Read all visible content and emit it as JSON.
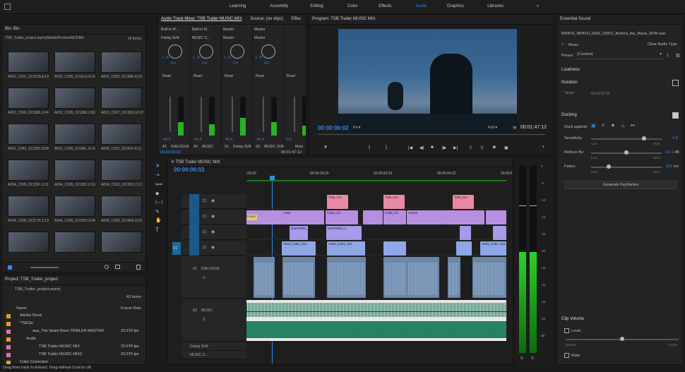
{
  "workspaces": [
    "Learning",
    "Assembly",
    "Editing",
    "Color",
    "Effects",
    "Audio",
    "Graphics",
    "Libraries"
  ],
  "active_workspace": "Audio",
  "more_glyph": "»",
  "bin": {
    "title": "Bin: Bin",
    "path": "TSB_Trailer_project.prproj\\Media\\Proxies\\AED\\Bin",
    "count": "18 Items",
    "clips": [
      {
        "name": "A002_C001_0213US...",
        "dur": "4:19"
      },
      {
        "name": "A002_C005_0213LG...",
        "dur": "4:16"
      },
      {
        "name": "A002_C005_02138K...",
        "dur": "4:23"
      },
      {
        "name": "A002_C000_021388...",
        "dur": "3:04"
      },
      {
        "name": "A002_C005_021388...",
        "dur": "3:06"
      },
      {
        "name": "A002_C007_02130G...",
        "dur": "10:07"
      },
      {
        "name": "A002_C042_021306...",
        "dur": "8:58"
      },
      {
        "name": "A001_C006_02130L...",
        "dur": "4:15"
      },
      {
        "name": "A004_C001_02156V...",
        "dur": "4:11"
      },
      {
        "name": "A004_C005_02135F...",
        "dur": "3:21"
      },
      {
        "name": "A004_C005_021350...",
        "dur": "3:16"
      },
      {
        "name": "A004_C005_02136X...",
        "dur": "2:12"
      },
      {
        "name": "A004_C006_02117H...",
        "dur": "2:13"
      },
      {
        "name": "A004_C006_02135H...",
        "dur": "3:04"
      },
      {
        "name": "A004_C006_0214KE...",
        "dur": "3:19"
      },
      {
        "name": "",
        "dur": ""
      },
      {
        "name": "",
        "dur": ""
      },
      {
        "name": "",
        "dur": ""
      }
    ]
  },
  "project": {
    "title": "Project: TSB_Trailer_project",
    "file": "TSB_Trailer_project.prproj",
    "count": "43 Items",
    "col_name": "Name",
    "col_rate": "Frame Rate",
    "items": [
      {
        "name": "Adobe Stock",
        "rate": "",
        "color": "#e0a030",
        "indent": 1
      },
      {
        "name": "**SEQs",
        "rate": "",
        "color": "#e0a030",
        "indent": 1
      },
      {
        "name": "aaa_The Seam  Boen TRAILER MASTER",
        "rate": "23.976 fps",
        "color": "#e070b0",
        "indent": 3
      },
      {
        "name": "Audio",
        "rate": "",
        "color": "#e0a030",
        "indent": 2
      },
      {
        "name": "TSB Trailer MUSIC MIX",
        "rate": "23.976 fps",
        "color": "#e070b0",
        "indent": 4
      },
      {
        "name": "TSB Trailer MUSIC MIX2",
        "rate": "23.976 fps",
        "color": "#e070b0",
        "indent": 4
      },
      {
        "name": "Color Correction",
        "rate": "",
        "color": "#e0a030",
        "indent": 1
      }
    ]
  },
  "status_bar": "Drag from track to Extract. Drag without Cmd to Lift.",
  "mixer": {
    "tab1": "Audio Track Mixer: TSB Trailer MUSIC MIX",
    "tab2": "Source: (no clips)",
    "tab3": "Effec",
    "timecode": "00:00:06:02",
    "duration": "00:01:47:12",
    "channels": [
      {
        "input": "Built-in M...",
        "output": "Dialog SUB",
        "value": "0.0",
        "auto": "Read",
        "peak": "-40.4",
        "lbl": "A1",
        "name": "DIALOGUE",
        "lr": "L  R",
        "level": 0.35
      },
      {
        "input": "Built-in M...",
        "output": "MUSIC S...",
        "value": "0.0",
        "auto": "Read",
        "peak": "-41.4",
        "lbl": "A2",
        "name": "MUSIC",
        "lr": "L  R",
        "level": 0.3
      },
      {
        "input": "Master",
        "output": "Master",
        "value": "0.0",
        "auto": "Read",
        "peak": "-40.4",
        "lbl": "S1",
        "name": "Dialog SUB",
        "lr": "L  R",
        "level": 0.45
      },
      {
        "input": "Master",
        "output": "Master",
        "value": "0.0",
        "auto": "Read",
        "peak": "-40.4",
        "lbl": "S2",
        "name": "MUSIC SUB",
        "lr": "L  R",
        "level": 0.35
      },
      {
        "input": "",
        "output": "",
        "value": "",
        "auto": "Read",
        "peak": "0.0",
        "lbl": "",
        "name": "Mast",
        "lr": "",
        "level": 0.25
      }
    ]
  },
  "program": {
    "title": "Program: TSB Trailer MUSIC MIX",
    "timecode": "00:00:06:02",
    "fit": "Fit",
    "quality": "Full",
    "duration": "00:01:47:12"
  },
  "timeline": {
    "title": "TSB Trailer MUSIC MIX",
    "timecode": "00:00:06:02",
    "ruler": [
      ":00:00",
      "00:00:14:23",
      "00:00:29:23",
      "00:00:44:22",
      "00:00:5"
    ],
    "video_tracks": [
      "V4",
      "V3",
      "V2",
      "V1"
    ],
    "audio_tracks": [
      "A1",
      "A2"
    ],
    "a1_name": "DIALOGUE",
    "a2_name": "MUSIC",
    "sub1": "Dialog SUB",
    "sub2": "MUSIC S...",
    "v1_src": "V1",
    "clip_labels": {
      "tsb1": "TSB_Cre",
      "tsb2": "TSB_Cre",
      "tsb3": "TSB_Cre",
      "a002": "A002",
      "c003": "C003_C0",
      "c005": "C005_C0",
      "c1": "C3025",
      "b1": "B15TR001_1",
      "b2": "B15TR001_1",
      "b3": "A003_C001_021",
      "b4": "A003_C001_021",
      "b5": "A003_C001_021",
      "cross": "Cross"
    },
    "a1_db": "0.",
    "a2_db": "0."
  },
  "meters": {
    "scale": [
      "0",
      "-6",
      "-12",
      "-18",
      "-24",
      "-30",
      "-36",
      "-42",
      "-48",
      "-54",
      "dB"
    ],
    "solo": "S"
  },
  "essential": {
    "title": "Essential Sound",
    "file": "MPATH_MPATH_0002_03001_Behind_the_Wave_APM.wav",
    "type": "Music",
    "clear": "Clear Audio Type",
    "preset_label": "Preset:",
    "preset_value": "(Custom)",
    "loudness": "Loudness",
    "duration": "Duration",
    "target_label": "Target",
    "target_value": "00:01:52:13",
    "ducking": "Ducking",
    "duck_against": "Duck against:",
    "sensitivity": "Sensitivity:",
    "sens_val": "4.8",
    "sens_min": "Low",
    "sens_max": "High",
    "reduce": "Reduce By:",
    "reduce_val": "-19.1",
    "reduce_unit": "dB",
    "reduce_min": "Less",
    "reduce_max": "More",
    "fades": "Fades:",
    "fades_val": "832",
    "fades_unit": "ms",
    "fades_min": "Fast",
    "fades_max": "Slow",
    "generate": "Generate Keyframes",
    "clip_volume": "Clip Volume",
    "level": "Level",
    "quieter": "Quieter",
    "louder": "Louder",
    "mute": "Mute",
    "sens_frac": 0.75,
    "reduce_frac": 0.5,
    "fades_frac": 0.25,
    "level_frac": 0.5
  }
}
